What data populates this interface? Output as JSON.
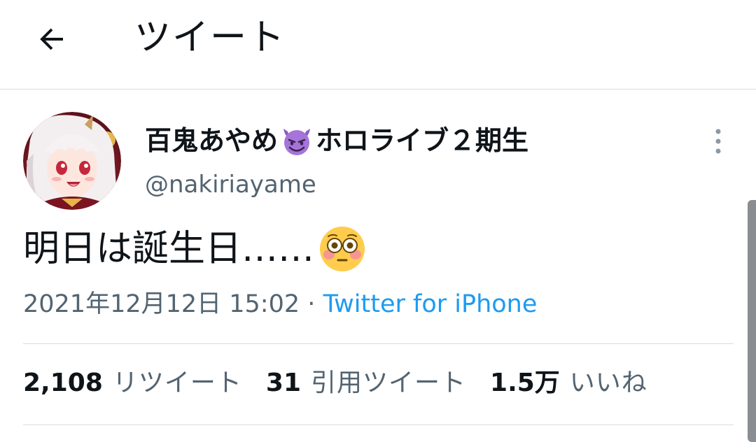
{
  "header": {
    "title": "ツイート",
    "back_icon": "arrow-left-icon"
  },
  "author": {
    "display_name_prefix": "百鬼あやめ",
    "display_name_emoji": "smiling-face-with-horns-emoji",
    "display_name_suffix": "ホロライブ２期生",
    "username": "@nakiriayame",
    "avatar": "anime-avatar",
    "more_icon": "more-vertical-icon"
  },
  "tweet": {
    "text": "明日は誕生日……",
    "text_emoji": "flushed-face-emoji",
    "timestamp": "2021年12月12日 15:02",
    "separator": "·",
    "source": "Twitter for iPhone"
  },
  "stats": {
    "retweets_count": "2,108",
    "retweets_label": "リツイート",
    "quotes_count": "31",
    "quotes_label": "引用ツイート",
    "likes_count": "1.5万",
    "likes_label": "いいね"
  },
  "colors": {
    "text_primary": "#0f1419",
    "text_secondary": "#536471",
    "link": "#1d9bf0",
    "divider": "#d7dbdf"
  }
}
